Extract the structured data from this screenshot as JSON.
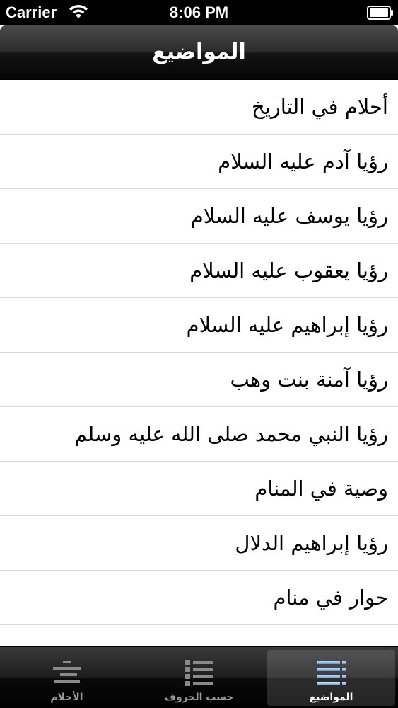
{
  "status_bar": {
    "carrier": "Carrier",
    "time": "8:06 PM",
    "wifi_icon": "wifi-icon",
    "battery_icon": "battery-icon"
  },
  "nav_bar": {
    "title": "المواضيع"
  },
  "topics": [
    {
      "label": "أحلام في التاريخ"
    },
    {
      "label": "رؤيا آدم عليه السلام"
    },
    {
      "label": "رؤيا يوسف عليه السلام"
    },
    {
      "label": "رؤيا يعقوب عليه السلام"
    },
    {
      "label": "رؤيا إبراهيم عليه السلام"
    },
    {
      "label": "رؤيا آمنة بنت وهب"
    },
    {
      "label": "رؤيا النبي محمد صلى الله عليه وسلم"
    },
    {
      "label": "وصية في المنام"
    },
    {
      "label": "رؤيا إبراهيم الدلال"
    },
    {
      "label": "حوار في منام"
    }
  ],
  "tab_bar": {
    "tabs": [
      {
        "label": "الأحلام",
        "icon": "align-lines-icon",
        "selected": false
      },
      {
        "label": "حسب الحروف",
        "icon": "bullet-list-icon",
        "selected": false
      },
      {
        "label": "المواضيع",
        "icon": "topics-list-icon",
        "selected": true
      }
    ]
  },
  "colors": {
    "accent_selected_icon": "#8fb6e8",
    "inactive_icon": "#8a8a8a"
  }
}
